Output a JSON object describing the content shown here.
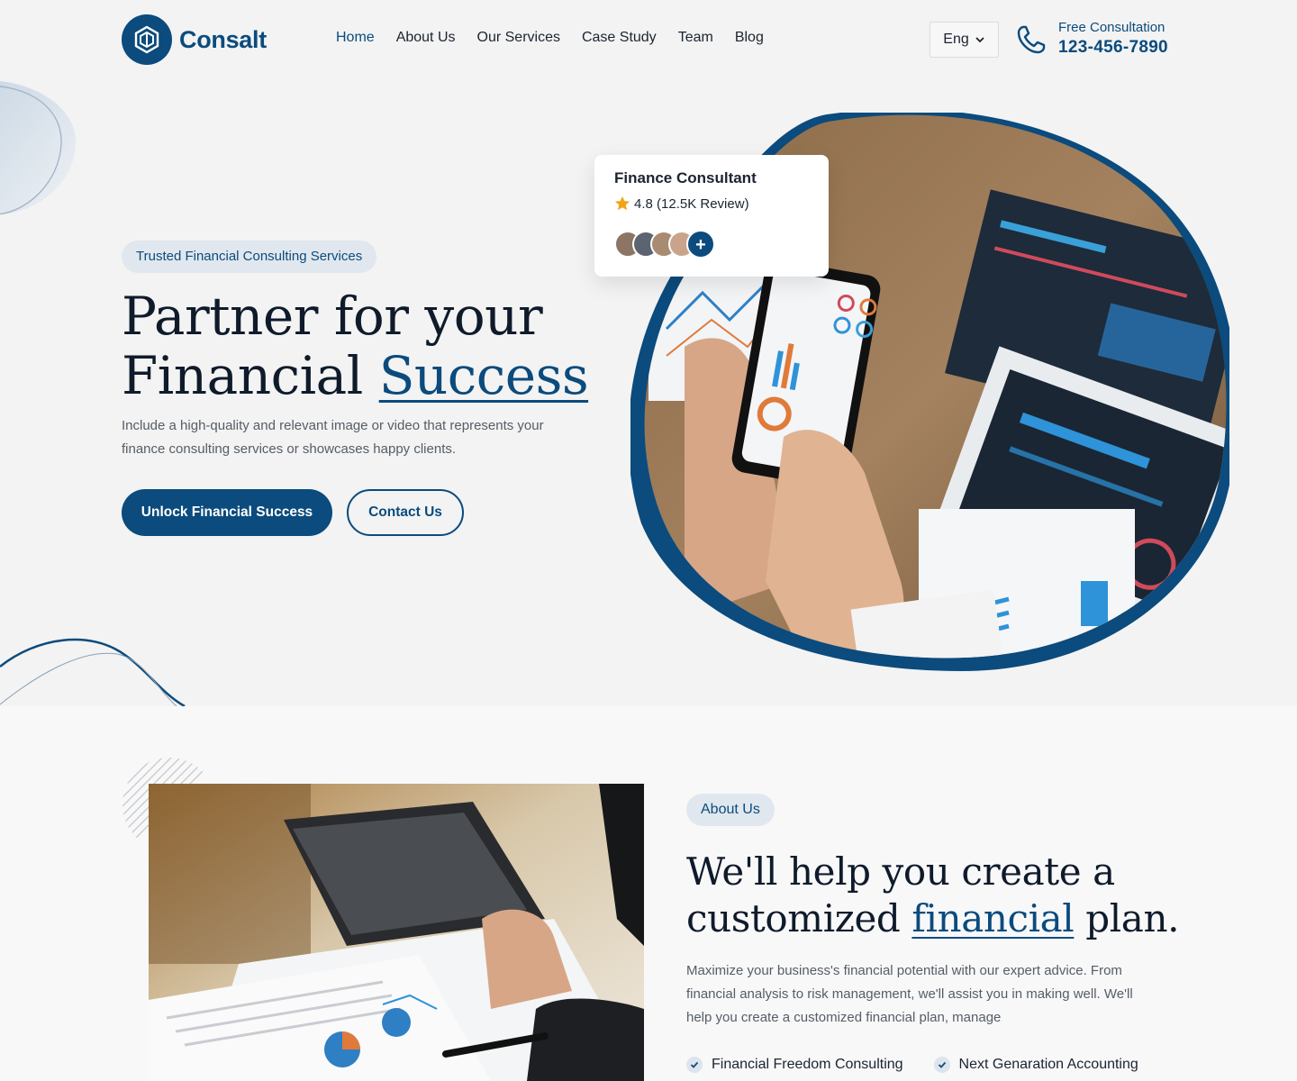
{
  "header": {
    "logo_text": "Consalt",
    "nav": [
      {
        "label": "Home",
        "active": true
      },
      {
        "label": "About Us",
        "active": false
      },
      {
        "label": "Our Services",
        "active": false
      },
      {
        "label": "Case Study",
        "active": false
      },
      {
        "label": "Team",
        "active": false
      },
      {
        "label": "Blog",
        "active": false
      }
    ],
    "language": "Eng",
    "phone_caption": "Free Consultation",
    "phone_number": "123-456-7890"
  },
  "hero": {
    "badge": "Trusted Financial Consulting Services",
    "title_line1": "Partner for your",
    "title_line2_plain": "Financial",
    "title_line2_highlight": "Success",
    "description": "Include a high-quality and relevant image or video that represents your finance consulting services or showcases happy clients.",
    "primary_button": "Unlock Financial Success",
    "secondary_button": "Contact Us",
    "card": {
      "title": "Finance Consultant",
      "rating": "4.8 (12.5K Review)",
      "add_symbol": "+"
    }
  },
  "about": {
    "badge": "About Us",
    "title_line1": "We'll help you create a",
    "title_line2_plain_before": "customized",
    "title_line2_highlight": "financial",
    "title_line2_plain_after": "plan.",
    "description": "Maximize your business's financial potential with our expert advice. From financial analysis to risk management, we'll assist you in making well. We'll help you create a customized financial plan, manage",
    "features": [
      "Financial Freedom Consulting",
      "Next Genaration Accounting"
    ]
  },
  "colors": {
    "brand": "#0b4b7d",
    "hero_bg": "#f3f3f3",
    "badge_bg": "#e1e7ee",
    "star": "#f2a417"
  },
  "icons": [
    "logo-mark-icon",
    "chevron-down-icon",
    "phone-icon",
    "star-icon",
    "check-icon",
    "plus-icon"
  ]
}
